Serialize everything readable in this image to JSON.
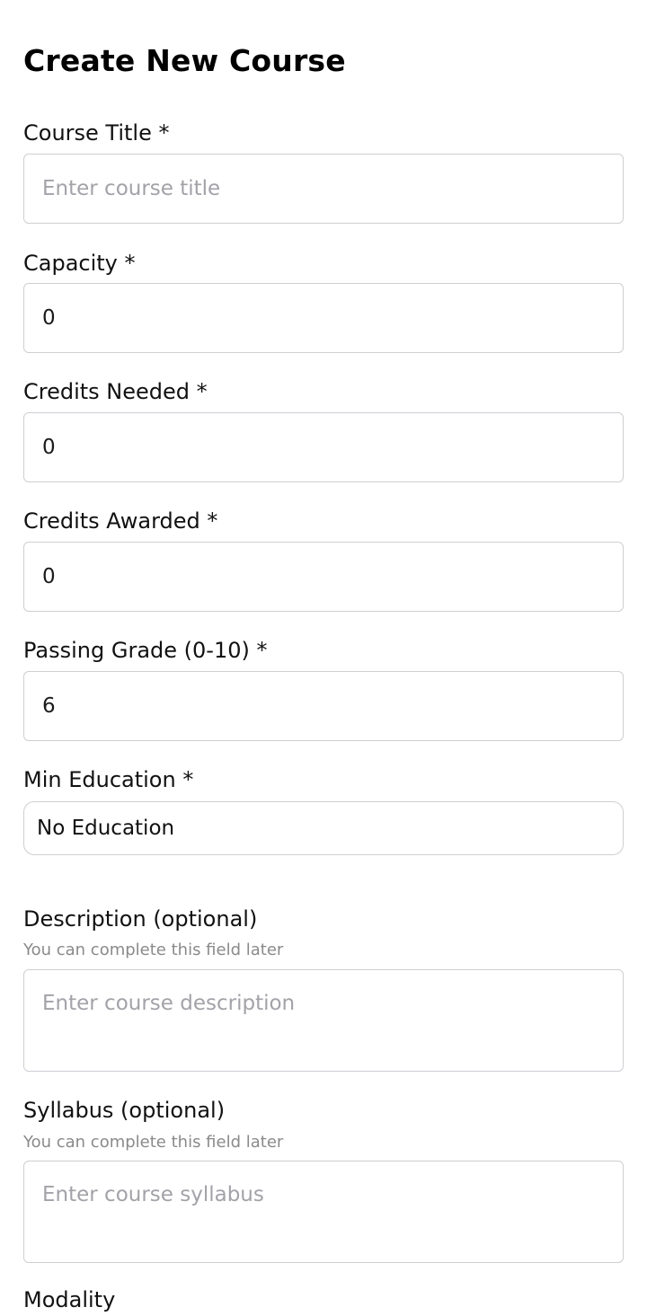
{
  "form": {
    "title": "Create New Course",
    "course_title": {
      "label": "Course Title *",
      "value": "",
      "placeholder": "Enter course title"
    },
    "capacity": {
      "label": "Capacity *",
      "value": "0"
    },
    "credits_needed": {
      "label": "Credits Needed *",
      "value": "0"
    },
    "credits_awarded": {
      "label": "Credits Awarded *",
      "value": "0"
    },
    "passing_grade": {
      "label": "Passing Grade (0-10) *",
      "value": "6"
    },
    "min_education": {
      "label": "Min Education *",
      "selected": "No Education"
    },
    "description": {
      "label": "Description (optional)",
      "hint": "You can complete this field later",
      "value": "",
      "placeholder": "Enter course description"
    },
    "syllabus": {
      "label": "Syllabus (optional)",
      "hint": "You can complete this field later",
      "value": "",
      "placeholder": "Enter course syllabus"
    },
    "modality": {
      "label": "Modality"
    }
  }
}
